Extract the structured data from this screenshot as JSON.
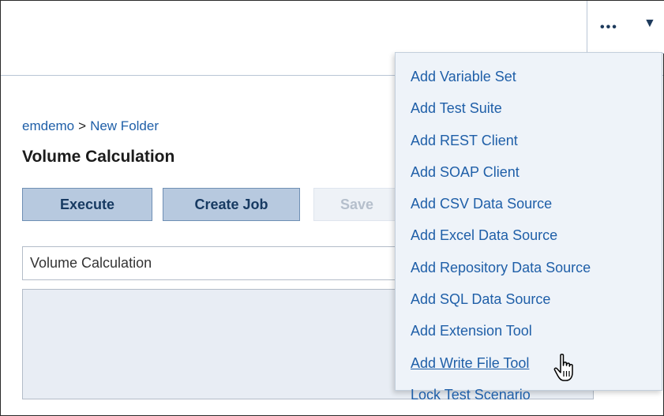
{
  "header": {
    "more_dots": "•••",
    "more_caret": "▼"
  },
  "breadcrumb": {
    "root": "emdemo",
    "separator": ">",
    "folder": "New Folder"
  },
  "page": {
    "title": "Volume Calculation"
  },
  "toolbar": {
    "execute_label": "Execute",
    "create_job_label": "Create Job",
    "save_label": "Save"
  },
  "form": {
    "name_value": "Volume Calculation",
    "description_value": ""
  },
  "menu": {
    "items": [
      {
        "label": "Add Variable Set"
      },
      {
        "label": "Add Test Suite"
      },
      {
        "label": "Add REST Client"
      },
      {
        "label": "Add SOAP Client"
      },
      {
        "label": "Add CSV Data Source"
      },
      {
        "label": "Add Excel Data Source"
      },
      {
        "label": "Add Repository Data Source"
      },
      {
        "label": "Add SQL Data Source"
      },
      {
        "label": "Add Extension Tool"
      },
      {
        "label": "Add Write File Tool"
      },
      {
        "label": "Lock Test Scenario"
      }
    ],
    "hovered_index": 9
  },
  "colors": {
    "link": "#1f5fa8",
    "button_bg": "#b7c9df",
    "menu_bg": "#eef3f9"
  },
  "icons": {
    "more": "more-dots-icon",
    "dropdown": "caret-down-icon",
    "cursor": "hand-pointer-icon"
  }
}
